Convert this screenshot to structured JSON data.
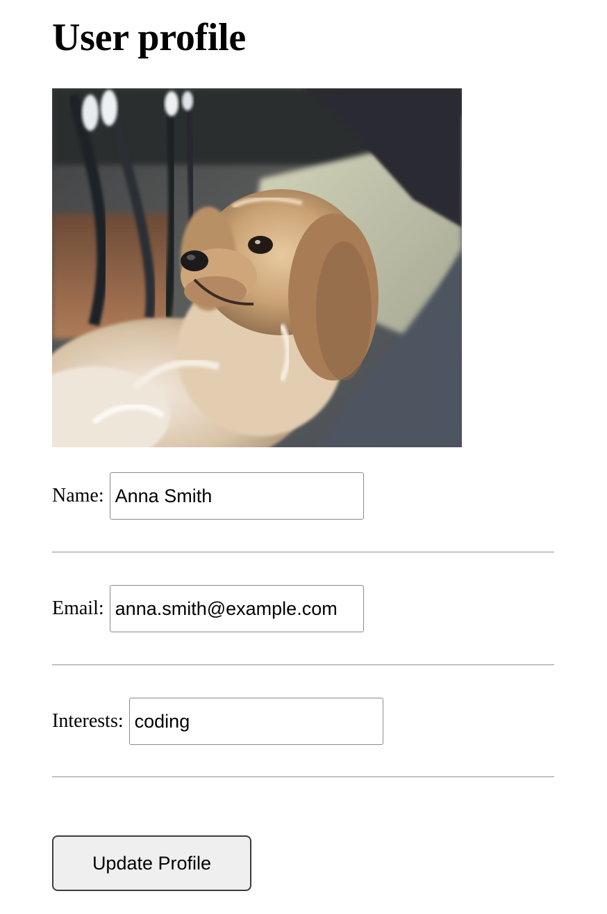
{
  "page": {
    "title": "User profile"
  },
  "profile_image": {
    "description_icon": "dog-photo"
  },
  "form": {
    "name": {
      "label": "Name:",
      "value": "Anna Smith"
    },
    "email": {
      "label": "Email:",
      "value": "anna.smith@example.com"
    },
    "interests": {
      "label": "Interests:",
      "value": "coding"
    },
    "submit_label": "Update Profile"
  }
}
